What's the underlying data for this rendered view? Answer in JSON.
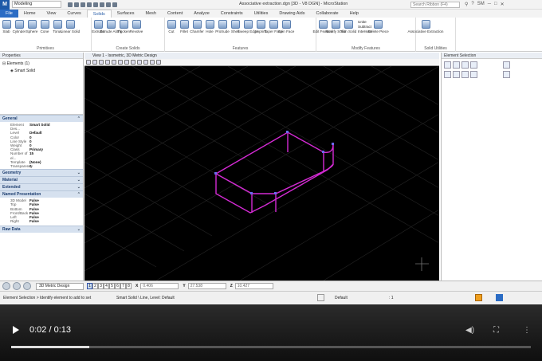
{
  "titlebar": {
    "workspace": "Modeling",
    "title": "Associative extraction.dgn [3D - V8 DGN] - MicroStation",
    "search_placeholder": "Search Ribbon (F4)",
    "user_initials": "SM"
  },
  "tabs": [
    "File",
    "Home",
    "View",
    "Curves",
    "Solids",
    "Surfaces",
    "Mesh",
    "Content",
    "Analyze",
    "Constraints",
    "Utilities",
    "Drawing Aids",
    "Collaborate",
    "Help"
  ],
  "active_tab": "Solids",
  "ribbon": {
    "primitives": {
      "label": "Primitives",
      "tools": [
        "Slab",
        "Cylinder",
        "Sphere",
        "Cone",
        "Torus",
        "Linear Solid"
      ]
    },
    "create": {
      "label": "Create Solids",
      "tools": [
        "Extrude",
        "Extrude Along",
        "Thicken",
        "Revolve"
      ]
    },
    "features": {
      "label": "Features",
      "tools": [
        "Cut",
        "Fillet",
        "Chamfer",
        "Hole",
        "Protrude",
        "Shell",
        "Sweep Edge",
        "Imprint",
        "Taper Face",
        "Spin Face"
      ]
    },
    "modify": {
      "label": "Modify Features",
      "tools": [
        "Edit Feature",
        "Modify Solid",
        "Trim Solid",
        "Delete Piece"
      ],
      "small": [
        "Unite",
        "Subtract",
        "Intersect"
      ]
    },
    "utilities": {
      "label": "Solid Utilities",
      "tools": [
        "Associative Extraction"
      ]
    }
  },
  "properties": {
    "title": "Properties",
    "tree": [
      "Elements (1)",
      "Smart Solid"
    ],
    "general_label": "General",
    "general": [
      {
        "k": "Element Des...",
        "v": "Smart Solid"
      },
      {
        "k": "Level",
        "v": "Default"
      },
      {
        "k": "Color",
        "v": "0"
      },
      {
        "k": "Line Style",
        "v": "0"
      },
      {
        "k": "Weight",
        "v": "0"
      },
      {
        "k": "Class",
        "v": "Primary"
      },
      {
        "k": "Number of el...",
        "v": "15"
      },
      {
        "k": "Template",
        "v": "(None)"
      },
      {
        "k": "Transparency",
        "v": "0"
      }
    ],
    "sections": [
      "Geometry",
      "Material",
      "Extended"
    ],
    "named_label": "Named Presentation",
    "named": [
      {
        "k": "3D Model",
        "v": "False"
      },
      {
        "k": "Top",
        "v": "False"
      },
      {
        "k": "Bottom",
        "v": "False"
      },
      {
        "k": "Front/Back",
        "v": "False"
      },
      {
        "k": "Left",
        "v": "False"
      },
      {
        "k": "Right",
        "v": "False"
      }
    ],
    "raw": "Raw Data"
  },
  "view": {
    "title": "View 1 - Isometric, 3D Metric Design"
  },
  "element_selection": {
    "title": "Element Selection"
  },
  "bottom": {
    "model": "3D Metric Design",
    "views": [
      "1",
      "2",
      "3",
      "4",
      "5",
      "6",
      "7",
      "8"
    ],
    "x_label": "X",
    "x_val": "0.406",
    "y_label": "Y",
    "y_val": "27.538",
    "z_label": "Z",
    "z_val": "10.427"
  },
  "status": {
    "prompt": "Element Selection > Identify element to add to set",
    "info": "Smart Solid \\ Line, Level: Default",
    "level": "Default",
    "point": ": 1"
  },
  "video": {
    "time": "0:02 / 0:13",
    "progress": 0.15
  }
}
